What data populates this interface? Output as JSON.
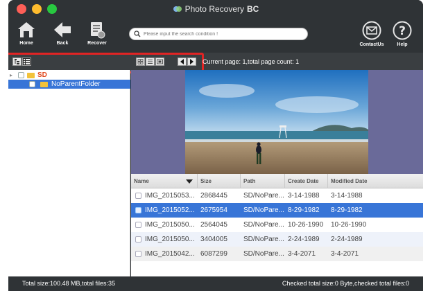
{
  "window": {
    "title": "Photo Recovery",
    "title_suffix": "BC"
  },
  "toolbar": {
    "home_label": "Home",
    "back_label": "Back",
    "recover_label": "Recover",
    "contact_label": "ContactUs",
    "help_label": "Help"
  },
  "search": {
    "placeholder": "Please input the search condition !",
    "value": ""
  },
  "pagination": {
    "text": "Current page: 1,total page count: 1"
  },
  "tree": {
    "root_label": "SD",
    "child_label": "NoParentFolder"
  },
  "table": {
    "columns": [
      "Name",
      "Size",
      "Path",
      "Create Date",
      "Modified Date"
    ],
    "rows": [
      {
        "name": "IMG_2015053...",
        "size": "2868445",
        "path": "SD/NoPare...",
        "created": "3-14-1988",
        "modified": "3-14-1988"
      },
      {
        "name": "IMG_2015052...",
        "size": "2675954",
        "path": "SD/NoPare...",
        "created": "8-29-1982",
        "modified": "8-29-1982"
      },
      {
        "name": "IMG_2015050...",
        "size": "2564045",
        "path": "SD/NoPare...",
        "created": "10-26-1990",
        "modified": "10-26-1990"
      },
      {
        "name": "IMG_2015050...",
        "size": "3404005",
        "path": "SD/NoPare...",
        "created": "2-24-1989",
        "modified": "2-24-1989"
      },
      {
        "name": "IMG_2015042...",
        "size": "6087299",
        "path": "SD/NoPare...",
        "created": "3-4-2071",
        "modified": "3-4-2071"
      }
    ],
    "selected_index": 1
  },
  "status": {
    "left": "Total size:100.48 MB,total files:35",
    "right": "Checked total size:0 Byte,checked total files:0"
  },
  "colors": {
    "selection": "#3875d7",
    "highlight_box": "#e22424",
    "toolbar_bg": "#2f3336"
  }
}
